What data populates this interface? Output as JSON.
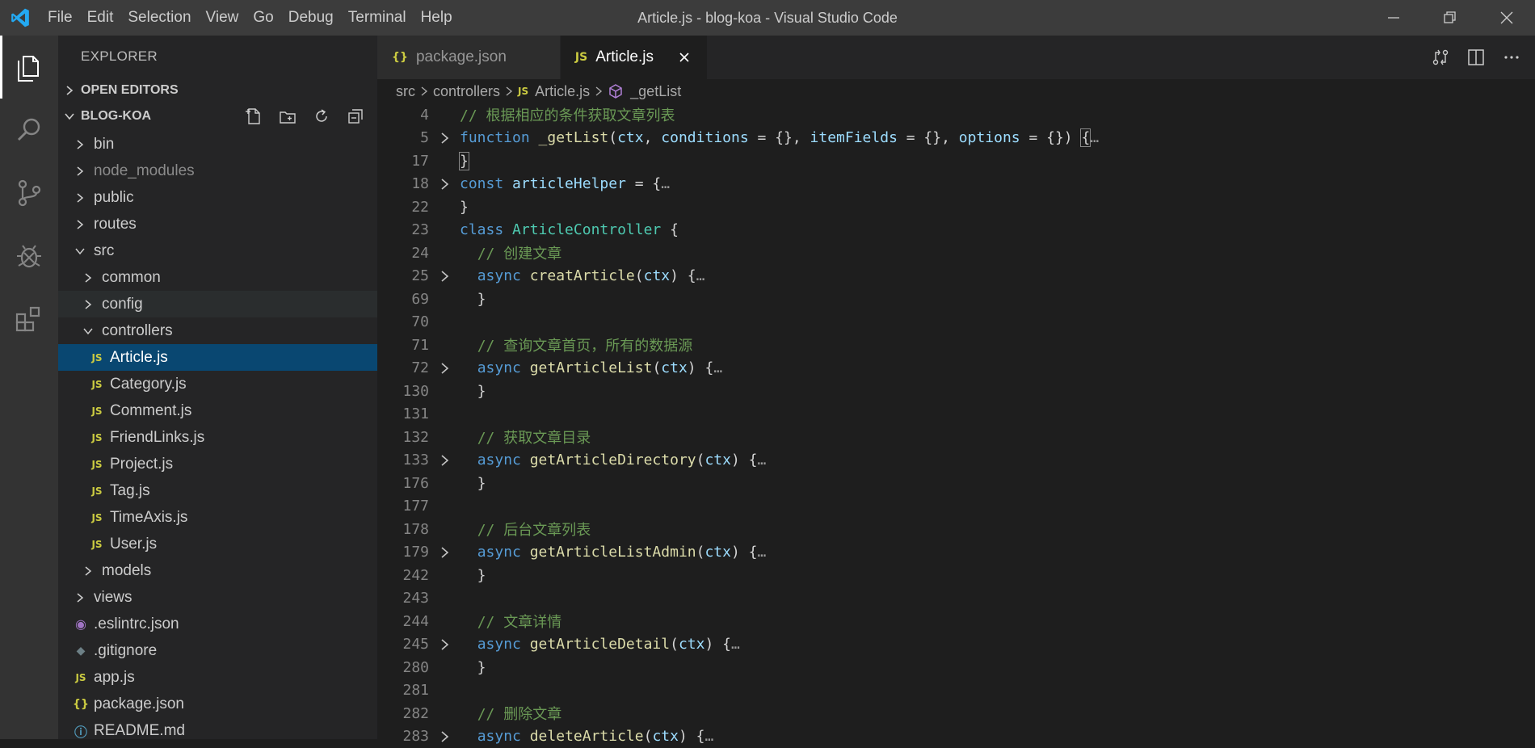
{
  "menu": [
    "File",
    "Edit",
    "Selection",
    "View",
    "Go",
    "Debug",
    "Terminal",
    "Help"
  ],
  "window_title": "Article.js - blog-koa - Visual Studio Code",
  "activity": [
    "files-icon",
    "search-icon",
    "source-control-icon",
    "debug-icon",
    "extensions-icon"
  ],
  "sidebar": {
    "title": "EXPLORER",
    "open_editors": "OPEN EDITORS",
    "project": "BLOG-KOA",
    "tree": [
      {
        "label": "bin",
        "depth": 1,
        "type": "folder",
        "open": false
      },
      {
        "label": "node_modules",
        "depth": 1,
        "type": "folder",
        "open": false,
        "dim": true
      },
      {
        "label": "public",
        "depth": 1,
        "type": "folder",
        "open": false
      },
      {
        "label": "routes",
        "depth": 1,
        "type": "folder",
        "open": false
      },
      {
        "label": "src",
        "depth": 1,
        "type": "folder",
        "open": true
      },
      {
        "label": "common",
        "depth": 2,
        "type": "folder",
        "open": false
      },
      {
        "label": "config",
        "depth": 2,
        "type": "folder",
        "open": false,
        "hover": true
      },
      {
        "label": "controllers",
        "depth": 2,
        "type": "folder",
        "open": true
      },
      {
        "label": "Article.js",
        "depth": 3,
        "type": "js",
        "selected": true
      },
      {
        "label": "Category.js",
        "depth": 3,
        "type": "js"
      },
      {
        "label": "Comment.js",
        "depth": 3,
        "type": "js"
      },
      {
        "label": "FriendLinks.js",
        "depth": 3,
        "type": "js"
      },
      {
        "label": "Project.js",
        "depth": 3,
        "type": "js"
      },
      {
        "label": "Tag.js",
        "depth": 3,
        "type": "js"
      },
      {
        "label": "TimeAxis.js",
        "depth": 3,
        "type": "js"
      },
      {
        "label": "User.js",
        "depth": 3,
        "type": "js"
      },
      {
        "label": "models",
        "depth": 2,
        "type": "folder",
        "open": false
      },
      {
        "label": "views",
        "depth": 1,
        "type": "folder",
        "open": false
      },
      {
        "label": ".eslintrc.json",
        "depth": 1,
        "type": "eslint"
      },
      {
        "label": ".gitignore",
        "depth": 1,
        "type": "git"
      },
      {
        "label": "app.js",
        "depth": 1,
        "type": "js"
      },
      {
        "label": "package.json",
        "depth": 1,
        "type": "json"
      },
      {
        "label": "README.md",
        "depth": 1,
        "type": "info"
      }
    ]
  },
  "tabs": [
    {
      "label": "package.json",
      "icon": "{}",
      "active": false
    },
    {
      "label": "Article.js",
      "icon": "JS",
      "active": true
    }
  ],
  "breadcrumb": [
    "src",
    "controllers",
    "Article.js",
    "_getList"
  ],
  "code_lines": [
    {
      "n": "4",
      "fold": false,
      "tokens": [
        [
          "cm",
          "// 根据相应的条件获取文章列表"
        ]
      ]
    },
    {
      "n": "5",
      "fold": true,
      "tokens": [
        [
          "kw",
          "function"
        ],
        [
          "pl",
          " "
        ],
        [
          "fn",
          "_getList"
        ],
        [
          "pl",
          "("
        ],
        [
          "var",
          "ctx"
        ],
        [
          "pl",
          ", "
        ],
        [
          "var",
          "conditions"
        ],
        [
          "pl",
          " = {}, "
        ],
        [
          "var",
          "itemFields"
        ],
        [
          "pl",
          " = {}, "
        ],
        [
          "var",
          "options"
        ],
        [
          "pl",
          " = {}) "
        ],
        [
          "cur",
          "{"
        ],
        [
          "ell",
          "…"
        ]
      ]
    },
    {
      "n": "17",
      "fold": false,
      "tokens": [
        [
          "cur",
          "}"
        ]
      ]
    },
    {
      "n": "18",
      "fold": true,
      "tokens": [
        [
          "kw",
          "const"
        ],
        [
          "pl",
          " "
        ],
        [
          "var",
          "articleHelper"
        ],
        [
          "pl",
          " = {"
        ],
        [
          "ell",
          "…"
        ]
      ]
    },
    {
      "n": "22",
      "fold": false,
      "tokens": [
        [
          "pl",
          "}"
        ]
      ]
    },
    {
      "n": "23",
      "fold": false,
      "tokens": [
        [
          "kw",
          "class"
        ],
        [
          "pl",
          " "
        ],
        [
          "cls",
          "ArticleController"
        ],
        [
          "pl",
          " {"
        ]
      ]
    },
    {
      "n": "24",
      "fold": false,
      "tokens": [
        [
          "pl",
          "  "
        ],
        [
          "cm",
          "// 创建文章"
        ]
      ]
    },
    {
      "n": "25",
      "fold": true,
      "tokens": [
        [
          "pl",
          "  "
        ],
        [
          "kw",
          "async"
        ],
        [
          "pl",
          " "
        ],
        [
          "fn",
          "creatArticle"
        ],
        [
          "pl",
          "("
        ],
        [
          "var",
          "ctx"
        ],
        [
          "pl",
          ") {"
        ],
        [
          "ell",
          "…"
        ]
      ]
    },
    {
      "n": "69",
      "fold": false,
      "tokens": [
        [
          "pl",
          "  }"
        ]
      ]
    },
    {
      "n": "70",
      "fold": false,
      "tokens": []
    },
    {
      "n": "71",
      "fold": false,
      "tokens": [
        [
          "pl",
          "  "
        ],
        [
          "cm",
          "// 查询文章首页，所有的数据源"
        ]
      ]
    },
    {
      "n": "72",
      "fold": true,
      "tokens": [
        [
          "pl",
          "  "
        ],
        [
          "kw",
          "async"
        ],
        [
          "pl",
          " "
        ],
        [
          "fn",
          "getArticleList"
        ],
        [
          "pl",
          "("
        ],
        [
          "var",
          "ctx"
        ],
        [
          "pl",
          ") {"
        ],
        [
          "ell",
          "…"
        ]
      ]
    },
    {
      "n": "130",
      "fold": false,
      "tokens": [
        [
          "pl",
          "  }"
        ]
      ]
    },
    {
      "n": "131",
      "fold": false,
      "tokens": []
    },
    {
      "n": "132",
      "fold": false,
      "tokens": [
        [
          "pl",
          "  "
        ],
        [
          "cm",
          "// 获取文章目录"
        ]
      ]
    },
    {
      "n": "133",
      "fold": true,
      "tokens": [
        [
          "pl",
          "  "
        ],
        [
          "kw",
          "async"
        ],
        [
          "pl",
          " "
        ],
        [
          "fn",
          "getArticleDirectory"
        ],
        [
          "pl",
          "("
        ],
        [
          "var",
          "ctx"
        ],
        [
          "pl",
          ") {"
        ],
        [
          "ell",
          "…"
        ]
      ]
    },
    {
      "n": "176",
      "fold": false,
      "tokens": [
        [
          "pl",
          "  }"
        ]
      ]
    },
    {
      "n": "177",
      "fold": false,
      "tokens": []
    },
    {
      "n": "178",
      "fold": false,
      "tokens": [
        [
          "pl",
          "  "
        ],
        [
          "cm",
          "// 后台文章列表"
        ]
      ]
    },
    {
      "n": "179",
      "fold": true,
      "tokens": [
        [
          "pl",
          "  "
        ],
        [
          "kw",
          "async"
        ],
        [
          "pl",
          " "
        ],
        [
          "fn",
          "getArticleListAdmin"
        ],
        [
          "pl",
          "("
        ],
        [
          "var",
          "ctx"
        ],
        [
          "pl",
          ") {"
        ],
        [
          "ell",
          "…"
        ]
      ]
    },
    {
      "n": "242",
      "fold": false,
      "tokens": [
        [
          "pl",
          "  }"
        ]
      ]
    },
    {
      "n": "243",
      "fold": false,
      "tokens": []
    },
    {
      "n": "244",
      "fold": false,
      "tokens": [
        [
          "pl",
          "  "
        ],
        [
          "cm",
          "// 文章详情"
        ]
      ]
    },
    {
      "n": "245",
      "fold": true,
      "tokens": [
        [
          "pl",
          "  "
        ],
        [
          "kw",
          "async"
        ],
        [
          "pl",
          " "
        ],
        [
          "fn",
          "getArticleDetail"
        ],
        [
          "pl",
          "("
        ],
        [
          "var",
          "ctx"
        ],
        [
          "pl",
          ") {"
        ],
        [
          "ell",
          "…"
        ]
      ]
    },
    {
      "n": "280",
      "fold": false,
      "tokens": [
        [
          "pl",
          "  }"
        ]
      ]
    },
    {
      "n": "281",
      "fold": false,
      "tokens": []
    },
    {
      "n": "282",
      "fold": false,
      "tokens": [
        [
          "pl",
          "  "
        ],
        [
          "cm",
          "// 删除文章"
        ]
      ]
    },
    {
      "n": "283",
      "fold": true,
      "tokens": [
        [
          "pl",
          "  "
        ],
        [
          "kw",
          "async"
        ],
        [
          "pl",
          " "
        ],
        [
          "fn",
          "deleteArticle"
        ],
        [
          "pl",
          "("
        ],
        [
          "var",
          "ctx"
        ],
        [
          "pl",
          ") {"
        ],
        [
          "ell",
          "…"
        ]
      ]
    }
  ],
  "colors": {
    "accent": "#0078d4",
    "selection": "#094771",
    "comment": "#6a9955",
    "keyword": "#569cd6",
    "function": "#dcdcaa",
    "variable": "#9cdcfe",
    "class": "#4ec9b0",
    "js_icon": "#cbcb41"
  }
}
